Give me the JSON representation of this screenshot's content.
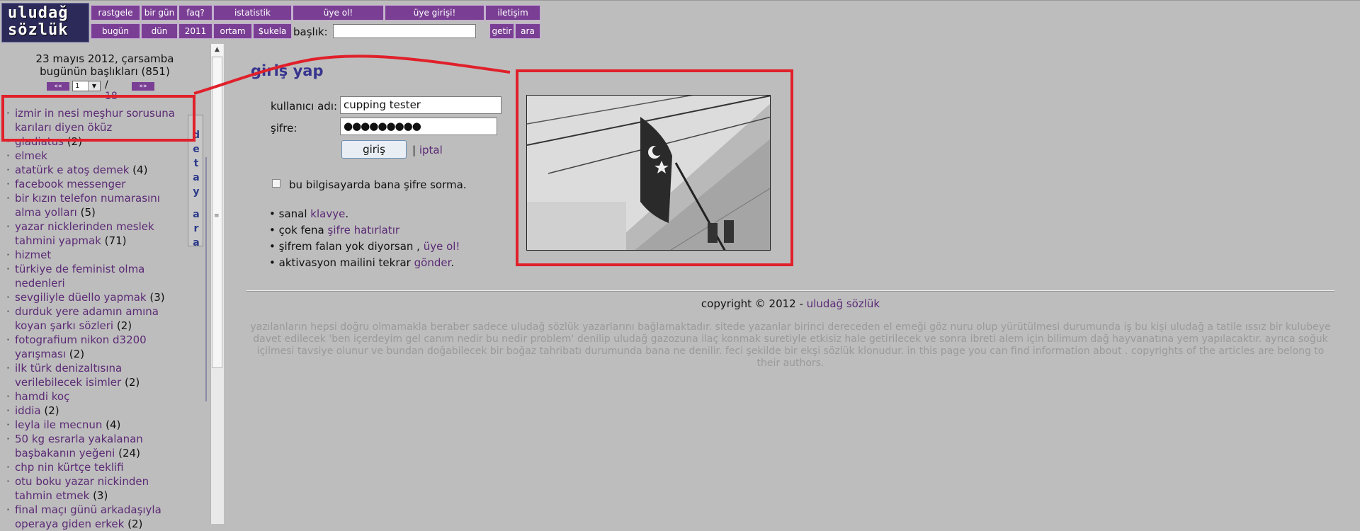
{
  "logo": {
    "line1": "uludağ",
    "line2": "sözlük"
  },
  "nav": {
    "row1": [
      "rastgele",
      "bir gün",
      "faq?",
      "istatistik",
      "üye ol!",
      "üye girişi!",
      "iletişim"
    ],
    "row2": [
      "bugün",
      "dün",
      "2011",
      "ortam",
      "$ukela"
    ],
    "search_label": "başlık:",
    "getir": "getir",
    "ara": "ara"
  },
  "sidebar": {
    "date": "23 mayıs 2012, çarsamba",
    "headline": "bugünün başlıkları (851)",
    "prev": "««",
    "next": "»»",
    "page": "1",
    "of": "/",
    "total": "18",
    "detay": [
      "d",
      "e",
      "t",
      "a",
      "y"
    ],
    "ara": [
      "a",
      "r",
      "a"
    ],
    "items": [
      {
        "title": "izmir in nesi meşhur sorusuna karıları diyen öküz",
        "count": ""
      },
      {
        "title": "gladiatus",
        "count": "(2)"
      },
      {
        "title": "elmek",
        "count": ""
      },
      {
        "title": "atatürk e atoş demek",
        "count": "(4)"
      },
      {
        "title": "facebook messenger",
        "count": ""
      },
      {
        "title": "bir kızın telefon numarasını alma yolları",
        "count": "(5)"
      },
      {
        "title": "yazar nicklerinden meslek tahmini yapmak",
        "count": "(71)"
      },
      {
        "title": "hizmet",
        "count": ""
      },
      {
        "title": "türkiye de feminist olma nedenleri",
        "count": ""
      },
      {
        "title": "sevgiliyle düello yapmak",
        "count": "(3)"
      },
      {
        "title": "durduk yere adamın amına koyan şarkı sözleri",
        "count": "(2)"
      },
      {
        "title": "fotografium nikon d3200 yarışması",
        "count": "(2)"
      },
      {
        "title": "ilk türk denizaltısına verilebilecek isimler",
        "count": "(2)"
      },
      {
        "title": "hamdi koç",
        "count": ""
      },
      {
        "title": "iddia",
        "count": "(2)"
      },
      {
        "title": "leyla ile mecnun",
        "count": "(4)"
      },
      {
        "title": "50 kg esrarla yakalanan başbakanın yeğeni",
        "count": "(24)"
      },
      {
        "title": "chp nin kürtçe teklifi",
        "count": ""
      },
      {
        "title": "otu boku yazar nickinden tahmin etmek",
        "count": "(3)"
      },
      {
        "title": "final maçı günü arkadaşıyla operaya giden erkek",
        "count": "(2)"
      }
    ]
  },
  "login": {
    "title": "giriş yap",
    "user_label": "kullanıcı adı:",
    "user_value": "cupping tester",
    "pass_label": "şifre:",
    "pass_value": "●●●●●●●●●",
    "submit": "giriş",
    "sep": "|",
    "cancel": "iptal",
    "remember": "bu bilgisayarda bana şifre sorma.",
    "b1_text": "sanal ",
    "b1_link": "klavye",
    "b1_end": ".",
    "b2_text": "çok fena ",
    "b2_link": "şifre hatırlatır",
    "b3_text": "şifrem falan yok diyorsan , ",
    "b3_link": "üye ol!",
    "b4_text": "aktivasyon mailini tekrar ",
    "b4_link": "gönder",
    "b4_end": ".",
    "bullet": "•"
  },
  "footer": {
    "copyright": "copyright © 2012 - ",
    "site": "uludağ sözlük",
    "disclaimer": "yazılanların hepsi doğru olmamakla beraber sadece uludağ sözlük yazarlarını bağlamaktadır. sitede yazanlar birinci dereceden el emeği göz nuru olup yürütülmesi durumunda iş bu kişi uludağ a tatile ıssız bir kulubeye davet edilecek 'ben içerdeyim gel canım nedir bu nedir problem' denilip uludağ gazozuna ilaç konmak suretiyle etkisiz hale getirilecek ve sonra ibreti alem için bilimum dağ hayvanatına yem yapılacaktır. ayrıca soğuk içilmesi tavsiye olunur ve bundan doğabilecek bir boğaz tahribatı durumunda bana ne denilir. feci şekilde bir ekşi sözlük klonudur. in this page you can find information about . copyrights of the articles are belong to their authors."
  },
  "colors": {
    "accent": "#7a3f94",
    "link": "#5b2a75",
    "annotation": "#e0202a"
  }
}
